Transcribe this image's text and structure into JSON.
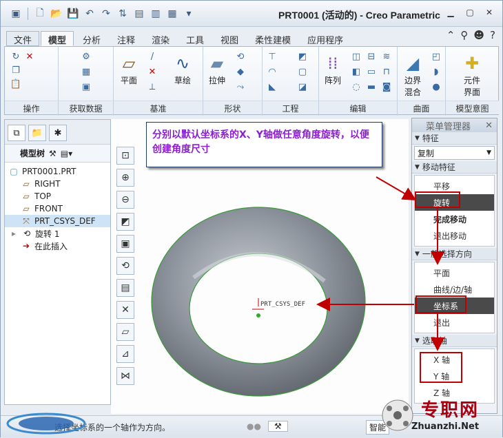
{
  "window": {
    "title": "PRT0001 (活动的) - Creo Parametric"
  },
  "quick_access": {
    "icons": [
      "app-icon",
      "new-icon",
      "open-icon",
      "save-icon",
      "undo-icon",
      "redo-icon",
      "regenerate-icon",
      "windows-icon",
      "close-window-icon",
      "folder-icon",
      "more-icon"
    ]
  },
  "tabs": [
    "文件",
    "模型",
    "分析",
    "注释",
    "渲染",
    "工具",
    "视图",
    "柔性建模",
    "应用程序"
  ],
  "ribbon": {
    "groups": {
      "operations": "操作",
      "get_data": "获取数据",
      "datum": "基准",
      "shapes": "形状",
      "engineering": "工程",
      "editing": "编辑",
      "surfaces": "曲面",
      "model_intent": "模型意图"
    },
    "buttons": {
      "plane": "平面",
      "sketch": "草绘",
      "extrude": "拉伸",
      "pattern": "阵列",
      "boundary_blend_1": "边界",
      "boundary_blend_2": "混合",
      "component_interface_1": "元件",
      "component_interface_2": "界面"
    }
  },
  "model_tree": {
    "header": "模型树",
    "items": [
      {
        "label": "PRT0001.PRT",
        "icon": "part-icon"
      },
      {
        "label": "RIGHT",
        "icon": "datum-plane-icon"
      },
      {
        "label": "TOP",
        "icon": "datum-plane-icon"
      },
      {
        "label": "FRONT",
        "icon": "datum-plane-icon"
      },
      {
        "label": "PRT_CSYS_DEF",
        "icon": "csys-icon"
      },
      {
        "label": "旋转 1",
        "icon": "revolve-icon"
      },
      {
        "label": "在此插入",
        "icon": "insert-arrow-icon"
      }
    ]
  },
  "callout": {
    "text": "分别以默认坐标系的X、Y轴做任意角度旋转，以便创建角度尺寸"
  },
  "graphics": {
    "csys_label": "PRT_CSYS_DEF"
  },
  "menu_manager": {
    "title": "菜单管理器",
    "section_feature": "特征",
    "dropdown": "复制",
    "section_move": "移动特征",
    "move_items": [
      "平移",
      "旋转",
      "完成移动",
      "退出移动"
    ],
    "section_direction": "一般选择方向",
    "direction_items": [
      "平面",
      "曲线/边/轴",
      "坐标系",
      "退出"
    ],
    "section_axis": "选取轴",
    "axis_items": [
      "X 轴",
      "Y 轴",
      "Z 轴"
    ]
  },
  "status": {
    "message": "选择坐标系的一个轴作为方向。",
    "smart": "智能"
  },
  "watermark": {
    "cn": "专职网",
    "url": "Zhuanzhi.Net"
  },
  "colors": {
    "callout_text": "#8a1fd0",
    "arrow": "#c00000",
    "highlight": "#4a4a4a"
  }
}
